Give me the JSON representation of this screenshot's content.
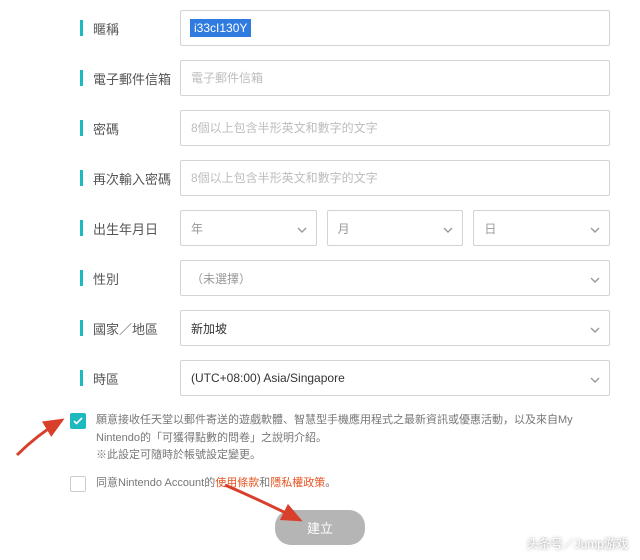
{
  "fields": {
    "nickname": {
      "label": "暱稱",
      "value": "i33cI130Y"
    },
    "email": {
      "label": "電子郵件信箱",
      "placeholder": "電子郵件信箱"
    },
    "password": {
      "label": "密碼",
      "placeholder": "8個以上包含半形英文和數字的文字"
    },
    "password_confirm": {
      "label": "再次輸入密碼",
      "placeholder": "8個以上包含半形英文和數字的文字"
    },
    "birthdate": {
      "label": "出生年月日",
      "year": "年",
      "month": "月",
      "day": "日"
    },
    "gender": {
      "label": "性別",
      "value": "（未選擇）"
    },
    "country": {
      "label": "國家／地區",
      "value": "新加坡"
    },
    "timezone": {
      "label": "時區",
      "value": "(UTC+08:00) Asia/Singapore"
    }
  },
  "consent": {
    "marketing": "願意接收任天堂以郵件寄送的遊戲軟體、智慧型手機應用程式之最新資訊或優惠活動，以及來自My Nintendo的「可獲得點數的問卷」之說明介紹。",
    "marketing_note": "※此設定可隨時於帳號設定變更。",
    "terms_prefix": "同意Nintendo Account的",
    "terms_link": "使用條款",
    "terms_and": "和",
    "privacy_link": "隱私權政策",
    "terms_suffix": "。"
  },
  "submit": "建立",
  "watermark": "头条号／Jump游戏"
}
